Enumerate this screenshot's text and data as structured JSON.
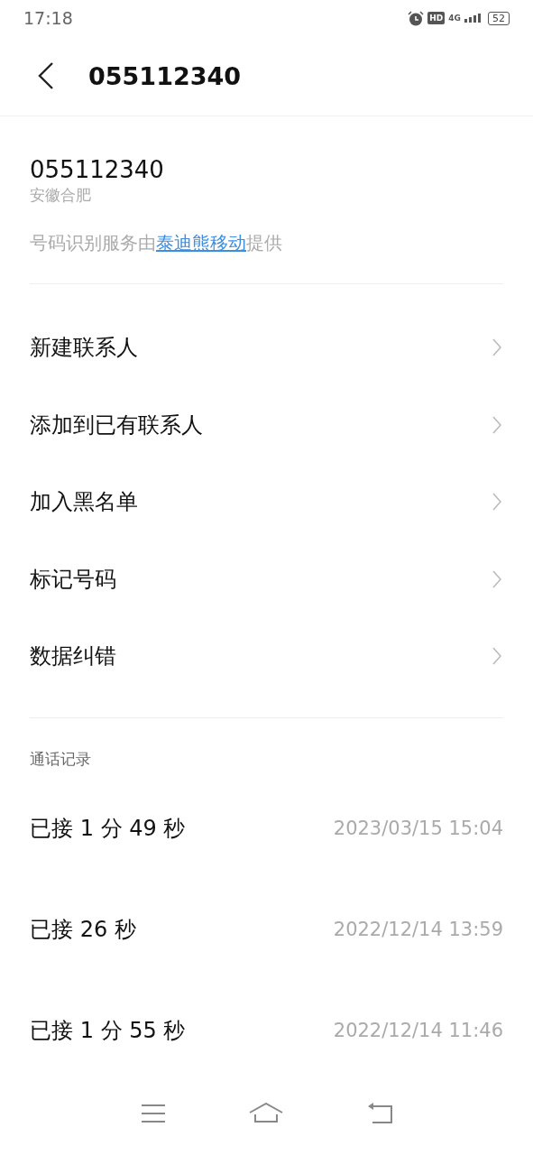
{
  "status_bar": {
    "time": "17:18",
    "hd": "HD",
    "network": "4G",
    "battery": "52"
  },
  "header": {
    "title": "055112340"
  },
  "caller": {
    "number": "055112340",
    "location": "安徽合肥",
    "service_prefix": "号码识别服务由",
    "service_link": "泰迪熊移动",
    "service_suffix": "提供"
  },
  "actions": [
    {
      "label": "新建联系人"
    },
    {
      "label": "添加到已有联系人"
    },
    {
      "label": "加入黑名单"
    },
    {
      "label": "标记号码"
    },
    {
      "label": "数据纠错"
    }
  ],
  "call_log": {
    "title": "通话记录",
    "rows": [
      {
        "status": "已接 1 分 49 秒",
        "time": "2023/03/15 15:04"
      },
      {
        "status": "已接 26 秒",
        "time": "2022/12/14 13:59"
      },
      {
        "status": "已接 1 分 55 秒",
        "time": "2022/12/14 11:46"
      }
    ]
  }
}
